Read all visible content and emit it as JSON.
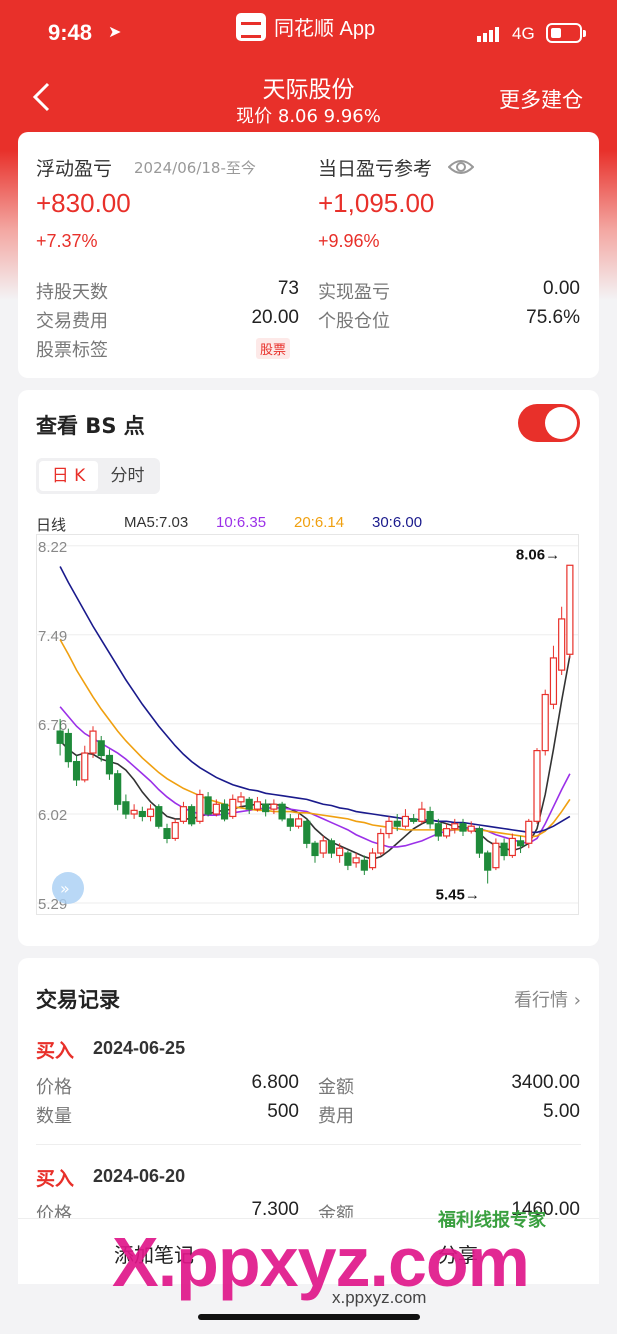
{
  "status": {
    "time": "9:48",
    "app": "同花顺 App",
    "network": "4G"
  },
  "nav": {
    "title": "天际股份",
    "subtitle": "现价 8.06 9.96%",
    "right": "更多建仓"
  },
  "pl": {
    "float_label": "浮动盈亏",
    "float_date": "2024/06/18-至今",
    "float_value": "+830.00",
    "float_pct": "+7.37%",
    "day_label": "当日盈亏参考",
    "day_value": "+1,095.00",
    "day_pct": "+9.96%",
    "stats": {
      "hold_days_label": "持股天数",
      "hold_days": "73",
      "fee_label": "交易费用",
      "fee": "20.00",
      "tag_label": "股票标签",
      "tag": "股票",
      "realized_label": "实现盈亏",
      "realized": "0.00",
      "position_label": "个股仓位",
      "position": "75.6%"
    }
  },
  "bs": {
    "title": "查看 BS 点",
    "tabs": [
      "日 K",
      "分时"
    ],
    "legend": {
      "period": "日线",
      "ma5": "MA5:7.03",
      "ma10": "10:6.35",
      "ma20": "20:6.14",
      "ma30": "30:6.00"
    },
    "colors": {
      "ma5": "#333333",
      "ma10": "#9b30e8",
      "ma20": "#f0a010",
      "ma30": "#1a1a8c",
      "up": "#e8302a",
      "down": "#1f8a3a"
    }
  },
  "chart_data": {
    "type": "candlestick",
    "y_ticks": [
      "8.22",
      "7.49",
      "6.76",
      "6.02",
      "5.29"
    ],
    "ylim": [
      5.2,
      8.3
    ],
    "high_label": "8.06→",
    "low_label": "5.45→",
    "candles": [
      [
        6.7,
        6.6,
        6.8,
        6.5
      ],
      [
        6.68,
        6.45,
        6.72,
        6.4
      ],
      [
        6.45,
        6.3,
        6.5,
        6.25
      ],
      [
        6.3,
        6.52,
        6.58,
        6.28
      ],
      [
        6.52,
        6.7,
        6.74,
        6.48
      ],
      [
        6.62,
        6.5,
        6.66,
        6.45
      ],
      [
        6.5,
        6.35,
        6.55,
        6.3
      ],
      [
        6.35,
        6.1,
        6.38,
        6.05
      ],
      [
        6.12,
        6.02,
        6.18,
        5.98
      ],
      [
        6.02,
        6.05,
        6.1,
        5.98
      ],
      [
        6.04,
        6.0,
        6.08,
        5.96
      ],
      [
        6.0,
        6.06,
        6.1,
        5.96
      ],
      [
        6.08,
        5.92,
        6.1,
        5.9
      ],
      [
        5.9,
        5.82,
        5.94,
        5.78
      ],
      [
        5.82,
        5.95,
        5.98,
        5.8
      ],
      [
        5.96,
        6.08,
        6.12,
        5.94
      ],
      [
        6.08,
        5.94,
        6.1,
        5.92
      ],
      [
        5.96,
        6.18,
        6.22,
        5.94
      ],
      [
        6.16,
        6.02,
        6.2,
        6.0
      ],
      [
        6.02,
        6.1,
        6.14,
        6.0
      ],
      [
        6.1,
        5.98,
        6.14,
        5.96
      ],
      [
        6.0,
        6.14,
        6.18,
        5.98
      ],
      [
        6.12,
        6.16,
        6.2,
        6.08
      ],
      [
        6.14,
        6.06,
        6.16,
        6.02
      ],
      [
        6.06,
        6.12,
        6.16,
        6.04
      ],
      [
        6.1,
        6.04,
        6.14,
        6.0
      ],
      [
        6.06,
        6.1,
        6.14,
        6.02
      ],
      [
        6.1,
        5.98,
        6.12,
        5.96
      ],
      [
        5.98,
        5.92,
        6.02,
        5.88
      ],
      [
        5.92,
        5.98,
        6.02,
        5.9
      ],
      [
        5.96,
        5.78,
        5.98,
        5.74
      ],
      [
        5.78,
        5.68,
        5.8,
        5.62
      ],
      [
        5.7,
        5.8,
        5.84,
        5.66
      ],
      [
        5.8,
        5.7,
        5.82,
        5.66
      ],
      [
        5.68,
        5.74,
        5.78,
        5.62
      ],
      [
        5.7,
        5.6,
        5.72,
        5.56
      ],
      [
        5.62,
        5.66,
        5.7,
        5.58
      ],
      [
        5.64,
        5.56,
        5.68,
        5.52
      ],
      [
        5.58,
        5.7,
        5.74,
        5.56
      ],
      [
        5.7,
        5.86,
        5.9,
        5.68
      ],
      [
        5.86,
        5.96,
        6.0,
        5.82
      ],
      [
        5.96,
        5.92,
        6.02,
        5.88
      ],
      [
        5.92,
        6.0,
        6.06,
        5.9
      ],
      [
        5.98,
        5.96,
        6.02,
        5.94
      ],
      [
        5.96,
        6.06,
        6.12,
        5.94
      ],
      [
        6.04,
        5.94,
        6.08,
        5.9
      ],
      [
        5.94,
        5.84,
        5.98,
        5.8
      ],
      [
        5.84,
        5.9,
        5.94,
        5.82
      ],
      [
        5.9,
        5.94,
        5.98,
        5.86
      ],
      [
        5.94,
        5.88,
        5.98,
        5.84
      ],
      [
        5.88,
        5.92,
        5.96,
        5.86
      ],
      [
        5.9,
        5.7,
        5.92,
        5.66
      ],
      [
        5.7,
        5.56,
        5.72,
        5.45
      ],
      [
        5.58,
        5.78,
        5.82,
        5.56
      ],
      [
        5.78,
        5.68,
        5.82,
        5.64
      ],
      [
        5.68,
        5.82,
        5.86,
        5.66
      ],
      [
        5.8,
        5.76,
        5.84,
        5.7
      ],
      [
        5.78,
        5.96,
        5.98,
        5.74
      ],
      [
        5.96,
        6.54,
        6.56,
        5.94
      ],
      [
        6.54,
        7.0,
        7.04,
        6.5
      ],
      [
        6.92,
        7.3,
        7.4,
        6.88
      ],
      [
        7.2,
        7.62,
        7.72,
        7.16
      ],
      [
        7.33,
        8.06,
        8.06,
        7.3
      ]
    ],
    "series": [
      {
        "name": "MA5",
        "values": [
          6.62,
          6.55,
          6.5,
          6.52,
          6.51,
          6.47,
          6.45,
          6.43,
          6.38,
          6.3,
          6.2,
          6.12,
          6.06,
          6.0,
          5.98,
          5.98,
          5.98,
          6.0,
          6.02,
          6.04,
          6.05,
          6.06,
          6.08,
          6.09,
          6.1,
          6.1,
          6.1,
          6.09,
          6.06,
          6.03,
          5.98,
          5.9,
          5.84,
          5.79,
          5.76,
          5.73,
          5.7,
          5.67,
          5.65,
          5.67,
          5.72,
          5.78,
          5.84,
          5.9,
          5.94,
          5.97,
          5.96,
          5.94,
          5.92,
          5.91,
          5.9,
          5.86,
          5.8,
          5.76,
          5.74,
          5.72,
          5.74,
          5.78,
          5.9,
          6.18,
          6.55,
          6.95,
          7.32
        ]
      },
      {
        "name": "MA10",
        "values": [
          6.9,
          6.82,
          6.74,
          6.68,
          6.64,
          6.6,
          6.56,
          6.52,
          6.47,
          6.41,
          6.35,
          6.29,
          6.22,
          6.16,
          6.11,
          6.07,
          6.04,
          6.02,
          6.01,
          6.01,
          6.02,
          6.03,
          6.04,
          6.05,
          6.06,
          6.07,
          6.07,
          6.07,
          6.06,
          6.05,
          6.04,
          6.01,
          5.98,
          5.95,
          5.92,
          5.89,
          5.85,
          5.82,
          5.79,
          5.77,
          5.75,
          5.75,
          5.76,
          5.78,
          5.8,
          5.83,
          5.86,
          5.88,
          5.89,
          5.9,
          5.9,
          5.9,
          5.88,
          5.85,
          5.83,
          5.81,
          5.79,
          5.78,
          5.82,
          5.94,
          6.08,
          6.22,
          6.35
        ]
      },
      {
        "name": "MA20",
        "values": [
          7.45,
          7.33,
          7.2,
          7.09,
          6.98,
          6.88,
          6.79,
          6.7,
          6.62,
          6.55,
          6.48,
          6.42,
          6.36,
          6.31,
          6.27,
          6.23,
          6.2,
          6.17,
          6.14,
          6.12,
          6.1,
          6.08,
          6.07,
          6.06,
          6.05,
          6.05,
          6.04,
          6.04,
          6.04,
          6.03,
          6.03,
          6.02,
          6.01,
          6.0,
          5.99,
          5.98,
          5.96,
          5.95,
          5.93,
          5.92,
          5.91,
          5.9,
          5.89,
          5.89,
          5.89,
          5.89,
          5.89,
          5.89,
          5.89,
          5.89,
          5.89,
          5.89,
          5.88,
          5.87,
          5.86,
          5.85,
          5.84,
          5.83,
          5.84,
          5.88,
          5.95,
          6.04,
          6.14
        ]
      },
      {
        "name": "MA30",
        "values": [
          8.05,
          7.92,
          7.8,
          7.68,
          7.56,
          7.45,
          7.34,
          7.23,
          7.12,
          7.02,
          6.92,
          6.83,
          6.74,
          6.66,
          6.58,
          6.51,
          6.45,
          6.4,
          6.36,
          6.32,
          6.29,
          6.26,
          6.24,
          6.22,
          6.21,
          6.19,
          6.18,
          6.17,
          6.16,
          6.15,
          6.14,
          6.12,
          6.1,
          6.09,
          6.07,
          6.06,
          6.04,
          6.03,
          6.02,
          6.01,
          6.0,
          5.99,
          5.98,
          5.98,
          5.97,
          5.97,
          5.96,
          5.96,
          5.95,
          5.95,
          5.94,
          5.93,
          5.92,
          5.91,
          5.9,
          5.89,
          5.88,
          5.87,
          5.87,
          5.89,
          5.92,
          5.96,
          6.0
        ]
      }
    ]
  },
  "records": {
    "title": "交易记录",
    "more": "看行情",
    "items": [
      {
        "type": "买入",
        "date": "2024-06-25",
        "price_label": "价格",
        "price": "6.800",
        "amount_label": "金额",
        "amount": "3400.00",
        "qty_label": "数量",
        "qty": "500",
        "fee_label": "费用",
        "fee": "5.00"
      },
      {
        "type": "买入",
        "date": "2024-06-20",
        "price_label": "价格",
        "price": "7.300",
        "amount_label": "金额",
        "amount": "1460.00"
      }
    ]
  },
  "bottom": {
    "add_note": "添加笔记",
    "share": "分享"
  },
  "watermark": {
    "big": "X.ppxyz.com",
    "url": "x.ppxyz.com",
    "brand": "福利线报专家"
  }
}
